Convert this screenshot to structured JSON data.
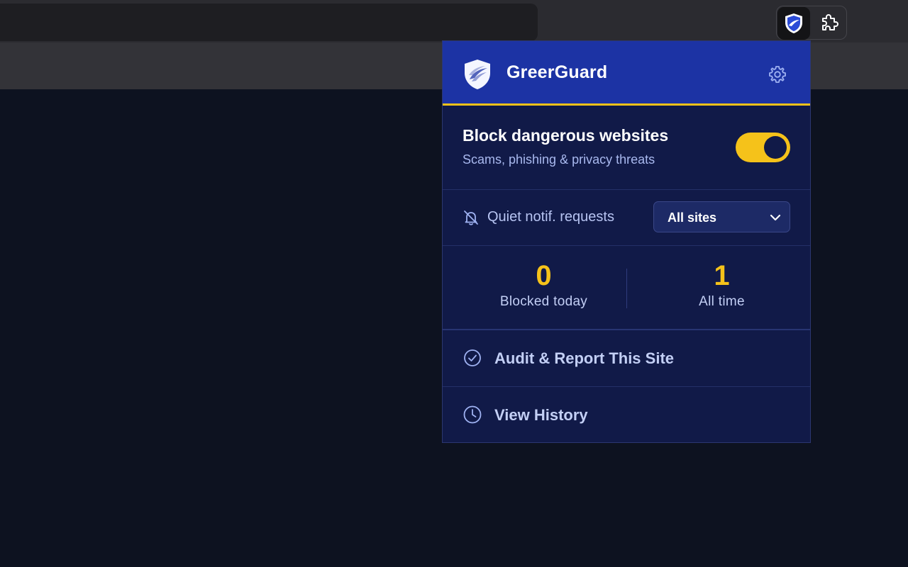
{
  "browser": {
    "toolbar": {
      "active_extension_icon": "shield-icon",
      "extensions_icon": "puzzle-icon"
    }
  },
  "popup": {
    "header": {
      "brand": "GreerGuard",
      "logo_icon": "shield-logo",
      "settings_icon": "gear-icon"
    },
    "protection": {
      "title": "Block dangerous websites",
      "subtitle": "Scams, phishing & privacy threats",
      "enabled": true
    },
    "notifications": {
      "label": "Quiet notif. requests",
      "icon": "bell-off-icon",
      "select_value": "All sites"
    },
    "stats": {
      "blocked_today_value": "0",
      "blocked_today_label": "Blocked today",
      "all_time_value": "1",
      "all_time_label": "All time"
    },
    "actions": {
      "audit_label": "Audit & Report This Site",
      "audit_icon": "check-circle-icon",
      "history_label": "View History",
      "history_icon": "clock-icon"
    }
  },
  "colors": {
    "header_bg": "#1c33a4",
    "popup_bg": "#111a48",
    "accent_yellow": "#f5c21a",
    "page_bg": "#0d1220"
  }
}
